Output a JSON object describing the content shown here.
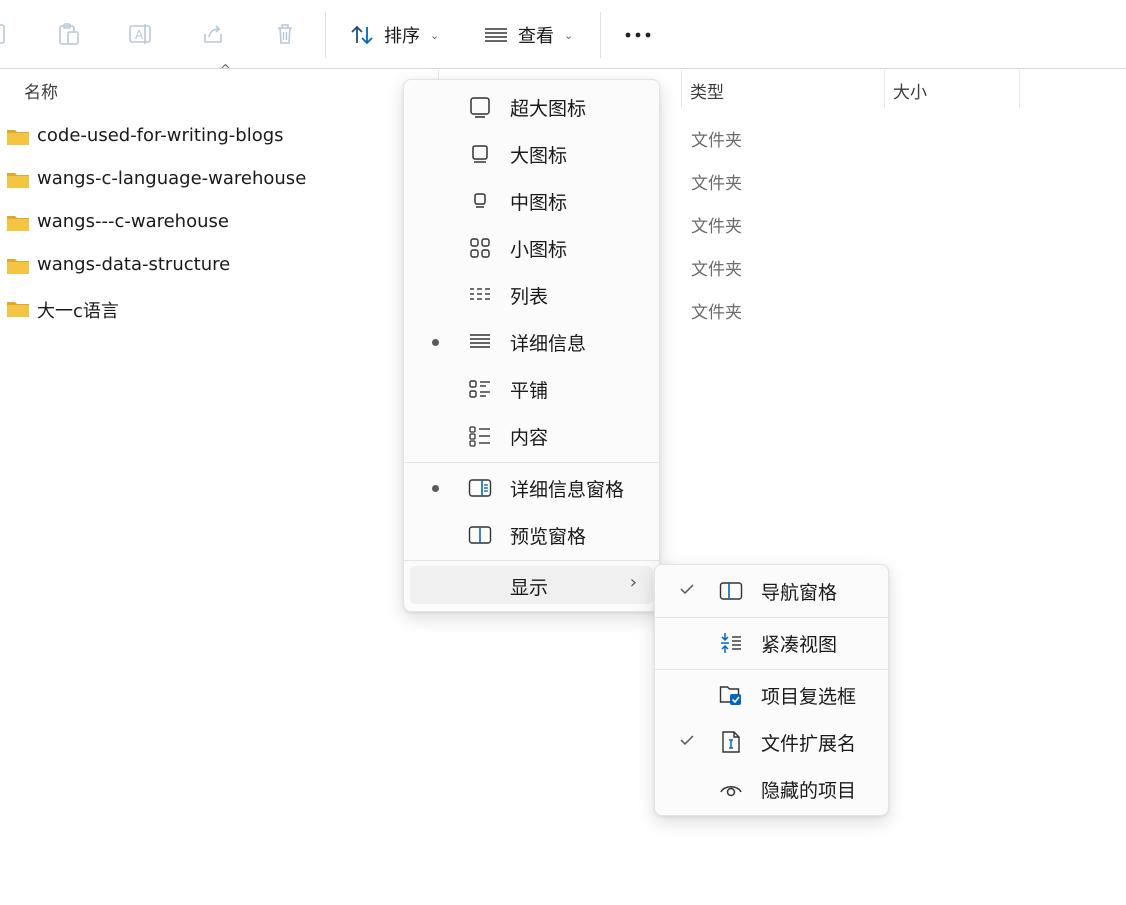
{
  "toolbar": {
    "sort_label": "排序",
    "view_label": "查看",
    "icons": [
      "new-icon",
      "paste-icon",
      "rename-icon",
      "share-icon",
      "delete-icon",
      "sort-icon",
      "view-icon",
      "more-icon"
    ]
  },
  "columns": {
    "name": "名称",
    "type": "类型",
    "size": "大小"
  },
  "files": [
    {
      "name": "code-used-for-writing-blogs",
      "type": "文件夹"
    },
    {
      "name": "wangs-c-language-warehouse",
      "type": "文件夹"
    },
    {
      "name": "wangs---c-warehouse",
      "type": "文件夹"
    },
    {
      "name": "wangs-data-structure",
      "type": "文件夹"
    },
    {
      "name": "大一c语言",
      "type": "文件夹"
    }
  ],
  "view_menu": {
    "items": [
      {
        "label": "超大图标",
        "icon": "extra-large-icons-icon",
        "selected": false
      },
      {
        "label": "大图标",
        "icon": "large-icons-icon",
        "selected": false
      },
      {
        "label": "中图标",
        "icon": "medium-icons-icon",
        "selected": false
      },
      {
        "label": "小图标",
        "icon": "small-icons-icon",
        "selected": false
      },
      {
        "label": "列表",
        "icon": "list-icon",
        "selected": false
      },
      {
        "label": "详细信息",
        "icon": "details-icon",
        "selected": true
      },
      {
        "label": "平铺",
        "icon": "tiles-icon",
        "selected": false
      },
      {
        "label": "内容",
        "icon": "content-icon",
        "selected": false
      }
    ],
    "panes": [
      {
        "label": "详细信息窗格",
        "icon": "details-pane-icon",
        "selected": true
      },
      {
        "label": "预览窗格",
        "icon": "preview-pane-icon",
        "selected": false
      }
    ],
    "show_label": "显示"
  },
  "show_menu": {
    "items": [
      {
        "label": "导航窗格",
        "icon": "navigation-pane-icon",
        "checked": true
      },
      {
        "label": "紧凑视图",
        "icon": "compact-view-icon",
        "checked": false
      },
      {
        "label": "项目复选框",
        "icon": "item-checkboxes-icon",
        "checked": false
      },
      {
        "label": "文件扩展名",
        "icon": "file-extensions-icon",
        "checked": true
      },
      {
        "label": "隐藏的项目",
        "icon": "hidden-items-icon",
        "checked": false
      }
    ]
  },
  "colors": {
    "accent": "#0067c0",
    "folder": "#f4c542",
    "folder_dark": "#e0a82e"
  }
}
